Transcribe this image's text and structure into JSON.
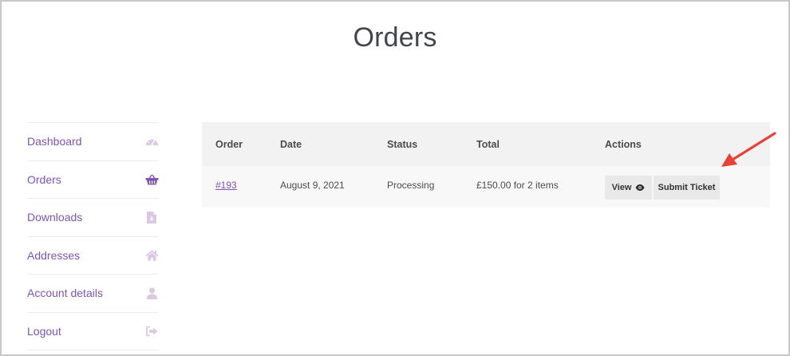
{
  "page": {
    "title": "Orders"
  },
  "nav": {
    "items": [
      {
        "label": "Dashboard",
        "icon": "dashboard-gauge-icon"
      },
      {
        "label": "Orders",
        "icon": "basket-icon"
      },
      {
        "label": "Downloads",
        "icon": "file-download-icon"
      },
      {
        "label": "Addresses",
        "icon": "home-icon"
      },
      {
        "label": "Account details",
        "icon": "user-icon"
      },
      {
        "label": "Logout",
        "icon": "sign-out-icon"
      }
    ]
  },
  "orders_table": {
    "headers": [
      "Order",
      "Date",
      "Status",
      "Total",
      "Actions"
    ],
    "rows": [
      {
        "order": "#193",
        "date": "August 9, 2021",
        "status": "Processing",
        "total": "£150.00 for 2 items",
        "actions": {
          "view_label": "View",
          "submit_label": "Submit Ticket"
        }
      }
    ]
  },
  "colors": {
    "accent": "#7f54b3",
    "icon_muted": "#d9c9e3",
    "arrow": "#e8413a"
  }
}
